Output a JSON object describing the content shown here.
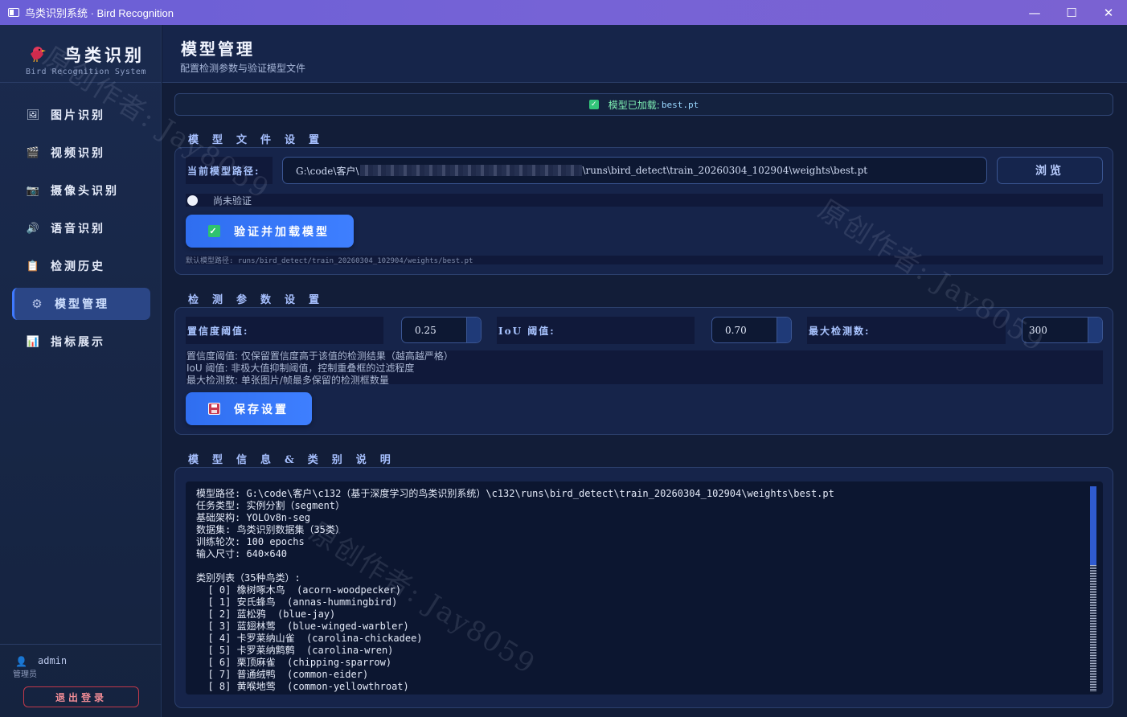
{
  "window": {
    "title": "鸟类识别系统 · Bird Recognition",
    "controls": {
      "minimize": "—",
      "maximize": "☐",
      "close": "✕"
    }
  },
  "sidebar": {
    "brand_name": "鸟类识别",
    "brand_subtitle": "Bird Recognition System",
    "items": [
      {
        "label": "图片识别",
        "icon": "image-icon",
        "glyph": "🖼"
      },
      {
        "label": "视频识别",
        "icon": "video-clapper-icon",
        "glyph": "🎬"
      },
      {
        "label": "摄像头识别",
        "icon": "camera-icon",
        "glyph": "📷"
      },
      {
        "label": "语音识别",
        "icon": "speaker-icon",
        "glyph": "🔊"
      },
      {
        "label": "检测历史",
        "icon": "clipboard-icon",
        "glyph": "📋"
      },
      {
        "label": "模型管理",
        "icon": "gear-icon",
        "glyph": "⚙"
      },
      {
        "label": "指标展示",
        "icon": "bar-chart-icon",
        "glyph": "📊"
      }
    ],
    "active_index": 5,
    "user": {
      "name": "admin",
      "role": "管理员",
      "icon": "user-icon",
      "glyph": "👤"
    },
    "logout_label": "退出登录"
  },
  "header": {
    "title": "模型管理",
    "subtitle": "配置检测参数与验证模型文件"
  },
  "status": {
    "text": "模型已加载: ",
    "filename": "best.pt",
    "icon": "check-icon"
  },
  "model_file": {
    "section_title": "模型文件设置",
    "path_label": "当前模型路径:",
    "path_prefix": "G:\\code\\客户\\",
    "path_suffix": "\\runs\\bird_detect\\train_20260304_102904\\weights\\best.pt",
    "browse_label": "浏览",
    "verify_state": "尚未验证",
    "load_button": "验证并加载模型",
    "default_hint": "默认模型路径: runs/bird_detect/train_20260304_102904/weights/best.pt"
  },
  "detect_params": {
    "section_title": "检测参数设置",
    "conf_label": "置信度阈值:",
    "conf_value": "0.25",
    "iou_label": "IoU 阈值:",
    "iou_value": "0.70",
    "max_label": "最大检测数:",
    "max_value": "300",
    "desc_line1": "置信度阈值: 仅保留置信度高于该值的检测结果（越高越严格）",
    "desc_line2": "IoU 阈值: 非极大值抑制阈值，控制重叠框的过滤程度",
    "desc_line3": "最大检测数: 单张图片/帧最多保留的检测框数量",
    "save_button": "保存设置"
  },
  "model_info": {
    "section_title": "模型信息&类别说明",
    "text": "模型路径: G:\\code\\客户\\c132（基于深度学习的鸟类识别系统）\\c132\\runs\\bird_detect\\train_20260304_102904\\weights\\best.pt\n任务类型: 实例分割（segment）\n基础架构: YOLOv8n-seg\n数据集: 鸟类识别数据集（35类）\n训练轮次: 100 epochs\n输入尺寸: 640×640\n\n类别列表（35种鸟类）:\n  [ 0] 橡树啄木鸟  (acorn-woodpecker)\n  [ 1] 安氏蜂鸟  (annas-hummingbird)\n  [ 2] 蓝松鸦  (blue-jay)\n  [ 3] 蓝翅林莺  (blue-winged-warbler)\n  [ 4] 卡罗莱纳山雀  (carolina-chickadee)\n  [ 5] 卡罗莱纳鹪鹩  (carolina-wren)\n  [ 6] 栗顶麻雀  (chipping-sparrow)\n  [ 7] 普通绒鸭  (common-eider)\n  [ 8] 黄喉地莺  (common-yellowthroat)"
  },
  "watermark": "原创作者: Jay8059"
}
